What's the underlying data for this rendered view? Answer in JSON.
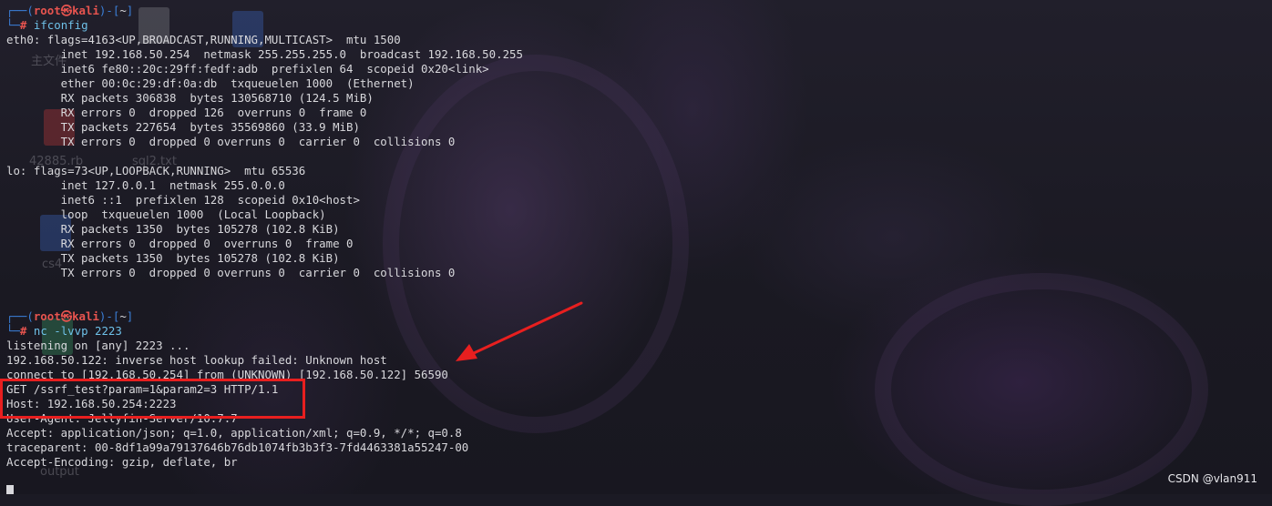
{
  "terminal": {
    "prompt_user": "root",
    "prompt_at": "㉿",
    "prompt_host": "kali",
    "prompt_dir": "~",
    "cmd1": "ifconfig",
    "cmd2": "nc -lvvp 2223",
    "ifconfig_lines": [
      "eth0: flags=4163<UP,BROADCAST,RUNNING,MULTICAST>  mtu 1500",
      "        inet 192.168.50.254  netmask 255.255.255.0  broadcast 192.168.50.255",
      "        inet6 fe80::20c:29ff:fedf:adb  prefixlen 64  scopeid 0x20<link>",
      "        ether 00:0c:29:df:0a:db  txqueuelen 1000  (Ethernet)",
      "        RX packets 306838  bytes 130568710 (124.5 MiB)",
      "        RX errors 0  dropped 126  overruns 0  frame 0",
      "        TX packets 227654  bytes 35569860 (33.9 MiB)",
      "        TX errors 0  dropped 0 overruns 0  carrier 0  collisions 0",
      "",
      "lo: flags=73<UP,LOOPBACK,RUNNING>  mtu 65536",
      "        inet 127.0.0.1  netmask 255.0.0.0",
      "        inet6 ::1  prefixlen 128  scopeid 0x10<host>",
      "        loop  txqueuelen 1000  (Local Loopback)",
      "        RX packets 1350  bytes 105278 (102.8 KiB)",
      "        RX errors 0  dropped 0  overruns 0  frame 0",
      "        TX packets 1350  bytes 105278 (102.8 KiB)",
      "        TX errors 0  dropped 0 overruns 0  carrier 0  collisions 0"
    ],
    "nc_lines": [
      "listening on [any] 2223 ...",
      "192.168.50.122: inverse host lookup failed: Unknown host",
      "connect to [192.168.50.254] from (UNKNOWN) [192.168.50.122] 56590",
      "GET /ssrf_test?param=1&param2=3 HTTP/1.1",
      "Host: 192.168.50.254:2223",
      "User-Agent: Jellyfin-Server/10.7.7",
      "Accept: application/json; q=1.0, application/xml; q=0.9, */*; q=0.8",
      "traceparent: 00-8df1a99a79137646b76db1074fb3b3f3-7fd4463381a55247-00",
      "Accept-Encoding: gzip, deflate, br"
    ]
  },
  "desktop_labels": [
    "主文件",
    "42885.rb",
    "sql2.txt",
    "cs4",
    "output"
  ],
  "watermark": "CSDN @vlan911",
  "colors": {
    "background": "#1b1a24",
    "text": "#d8d8dc",
    "prompt_frame": "#3b7fd8",
    "prompt_root": "#e8544f",
    "command": "#6ec0e8",
    "annotation": "#e81f1f"
  }
}
